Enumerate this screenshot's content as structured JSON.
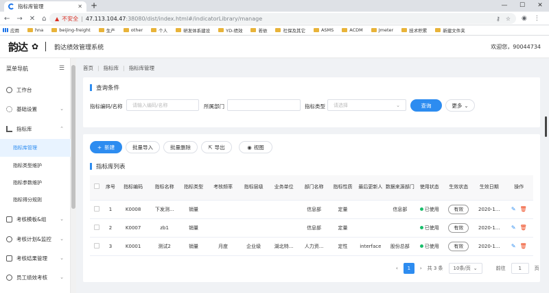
{
  "browser": {
    "tab_title": "指标库管理",
    "url_warning": "不安全",
    "url_host": "47.113.104.47",
    "url_path": ":38080/dist/index.html#/indicatorLibrary/manage",
    "bookmarks": [
      "应用",
      "hna",
      "beijing-freight",
      "生产",
      "other",
      "个人",
      "研发体系建设",
      "YD-绩效",
      "若依",
      "社保及其它",
      "ASMS",
      "ACDM",
      "Jmeter",
      "技术积累",
      "新建文件夹"
    ]
  },
  "app": {
    "logo_text": "韵达",
    "logo_sub": "EXPRESS",
    "system_name": "韵达绩效管理系统",
    "welcome": "欢迎您，90044734"
  },
  "sidebar": {
    "title": "菜单导航",
    "items": [
      {
        "label": "工作台"
      },
      {
        "label": "基础设置"
      },
      {
        "label": "指标库"
      }
    ],
    "subitems": [
      "指标库管理",
      "指标类型维护",
      "指标参数维护",
      "指标得分规则"
    ],
    "items_after": [
      "考核模板&组",
      "考核计划&监控",
      "考核结果管理",
      "员工绩效考核"
    ]
  },
  "breadcrumb": [
    "首页",
    "指标库",
    "指标库管理"
  ],
  "query": {
    "title": "查询条件",
    "code_label": "指标编码/名称",
    "code_placeholder": "请输入编码/名称",
    "dept_label": "所属部门",
    "type_label": "指标类型",
    "type_placeholder": "请选择",
    "search_label": "查询",
    "more_label": "更多"
  },
  "toolbar": {
    "new_label": "新建",
    "import_label": "批量导入",
    "delete_label": "批量删除",
    "export_label": "导出",
    "view_label": "视图"
  },
  "list": {
    "title": "指标库列表",
    "columns": [
      "序号",
      "指标编码",
      "指标名称",
      "指标类型",
      "考核频率",
      "指标层级",
      "业务单位",
      "部门名称",
      "指标性质",
      "最后更新人",
      "数据来源部门",
      "使用状态",
      "生效状态",
      "生效日期",
      "操作"
    ],
    "rows": [
      {
        "no": "1",
        "code": "K0008",
        "name": "下发测...",
        "type": "销量",
        "freq": "",
        "level": "",
        "unit": "",
        "dept": "信息部",
        "nature": "定量",
        "updater": "",
        "source": "信息部",
        "status": "已使用",
        "effect": "有效",
        "date": "2020-1..."
      },
      {
        "no": "2",
        "code": "K0007",
        "name": "zb1",
        "type": "销量",
        "freq": "",
        "level": "",
        "unit": "",
        "dept": "信息部",
        "nature": "定量",
        "updater": "",
        "source": "",
        "status": "已使用",
        "effect": "有效",
        "date": "2020-1..."
      },
      {
        "no": "3",
        "code": "K0001",
        "name": "测试2",
        "type": "销量",
        "freq": "月度",
        "level": "企业级",
        "unit": "湖北特...",
        "dept": "人力资...",
        "nature": "定性",
        "updater": "interface",
        "source": "股份总部",
        "status": "已使用",
        "effect": "有效",
        "date": "2020-1..."
      }
    ]
  },
  "pager": {
    "current": "1",
    "total": "共 3 条",
    "size": "10条/页",
    "goto_label": "前往",
    "goto_value": "1",
    "page_unit": "页"
  },
  "colors": {
    "primary": "#2d8cf0",
    "success": "#19be6b",
    "danger": "#ed4014"
  }
}
